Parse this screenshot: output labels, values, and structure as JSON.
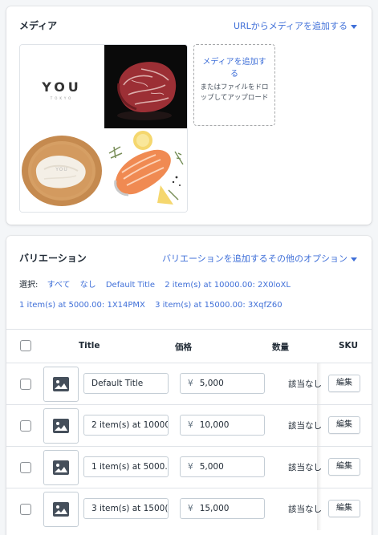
{
  "media": {
    "title": "メディア",
    "add_url_label": "URLからメディアを追加する",
    "dropzone": {
      "link": "メディアを追加する",
      "hint": "またはファイルをドロップしてアップロード"
    },
    "logo": {
      "name": "YOU",
      "sub": "TOKYO"
    }
  },
  "variants": {
    "title": "バリエーション",
    "add_label": "バリエーションを追加する",
    "more_label": "その他のオプション",
    "select": {
      "label": "選択:",
      "options": [
        "すべて",
        "なし",
        "Default Title",
        "2 item(s) at 10000.00: 2X0loXL",
        "1 item(s) at 5000.00: 1X14PMX",
        "3 item(s) at 15000.00: 3XqfZ60"
      ]
    },
    "columns": {
      "title": "Title",
      "price": "価格",
      "qty": "数量",
      "sku": "SKU"
    },
    "currency": "¥",
    "rows": [
      {
        "title": "Default Title",
        "price": "5,000",
        "qty": "該当なし",
        "action": "編集"
      },
      {
        "title": "2 item(s) at 10000",
        "price": "10,000",
        "qty": "該当なし",
        "action": "編集"
      },
      {
        "title": "1 item(s) at 5000.",
        "price": "5,000",
        "qty": "該当なし",
        "action": "編集"
      },
      {
        "title": "3 item(s) at 1500(",
        "price": "15,000",
        "qty": "該当なし",
        "action": "編集"
      }
    ]
  },
  "colors": {
    "accent": "#3f6fd8",
    "border": "#dfe3e8",
    "text": "#212b36"
  }
}
